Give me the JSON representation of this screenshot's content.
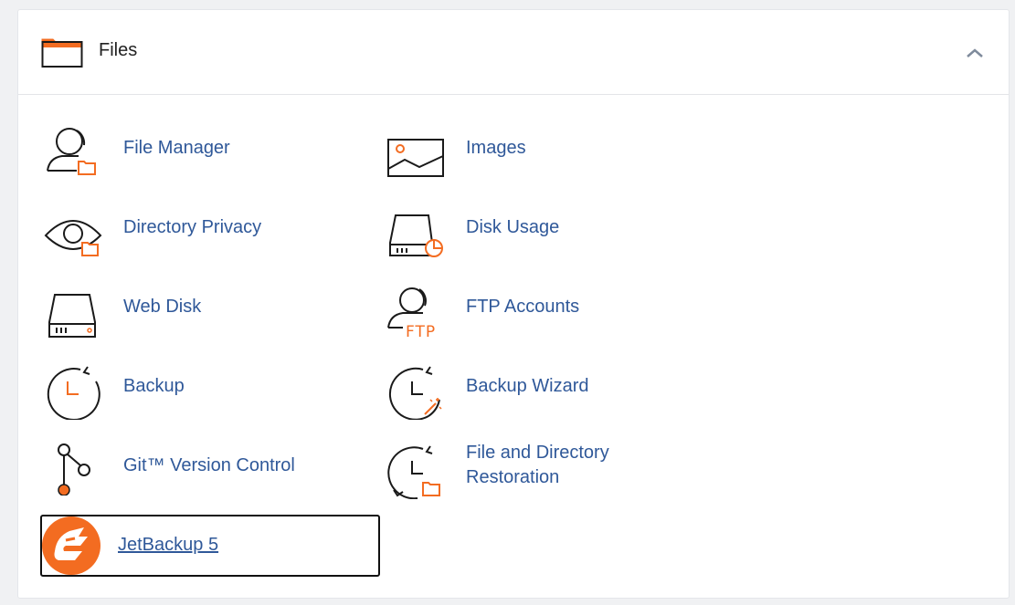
{
  "section": {
    "title": "Files",
    "collapse_icon": "chevron-up-icon"
  },
  "items": [
    {
      "label": "File Manager",
      "icon": "file-manager-icon"
    },
    {
      "label": "Images",
      "icon": "images-icon"
    },
    {
      "label": "Directory Privacy",
      "icon": "directory-privacy-icon"
    },
    {
      "label": "Disk Usage",
      "icon": "disk-usage-icon"
    },
    {
      "label": "Web Disk",
      "icon": "web-disk-icon"
    },
    {
      "label": "FTP Accounts",
      "icon": "ftp-accounts-icon",
      "icon_text": "FTP"
    },
    {
      "label": "Backup",
      "icon": "backup-icon"
    },
    {
      "label": "Backup Wizard",
      "icon": "backup-wizard-icon"
    },
    {
      "label": "Git™ Version Control",
      "icon": "git-icon"
    },
    {
      "label": "File and Directory Restoration",
      "icon": "restoration-icon"
    },
    {
      "label": "JetBackup 5",
      "icon": "jetbackup-icon"
    }
  ],
  "colors": {
    "accent": "#f36c21",
    "link": "#2f5899",
    "icon_stroke": "#1a1a1a"
  }
}
